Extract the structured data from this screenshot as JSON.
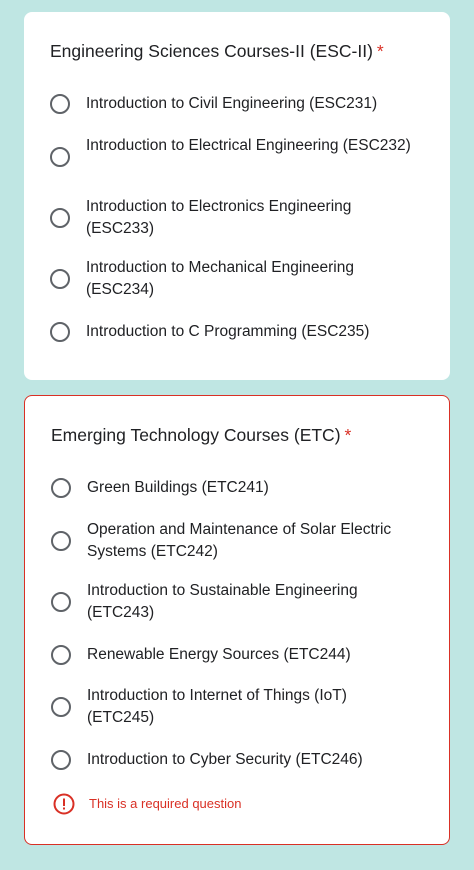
{
  "question1": {
    "title": "Engineering Sciences Courses-II  (ESC-II)",
    "required_mark": "*",
    "options": [
      {
        "label": "Introduction to Civil Engineering (ESC231)"
      },
      {
        "label": "Introduction to Electrical Engineering (ESC232)"
      },
      {
        "label": "Introduction to Electronics Engineering (ESC233)"
      },
      {
        "label": "Introduction to Mechanical Engineering (ESC234)"
      },
      {
        "label": "Introduction to C Programming (ESC235)"
      }
    ]
  },
  "question2": {
    "title": "Emerging Technology Courses  (ETC)",
    "required_mark": "*",
    "options": [
      {
        "label": "Green Buildings (ETC241)"
      },
      {
        "label": "Operation and Maintenance of Solar Electric Systems (ETC242)"
      },
      {
        "label": "Introduction to Sustainable Engineering (ETC243)"
      },
      {
        "label": "Renewable Energy Sources (ETC244)"
      },
      {
        "label": "Introduction to Internet of Things (IoT) (ETC245)"
      },
      {
        "label": "Introduction to Cyber Security (ETC246)"
      }
    ],
    "error": {
      "icon": "error-icon",
      "text": "This is a required question"
    }
  },
  "colors": {
    "background": "#bfe6e3",
    "required": "#d93025",
    "radio_border": "#5f6368",
    "text": "#202124"
  }
}
